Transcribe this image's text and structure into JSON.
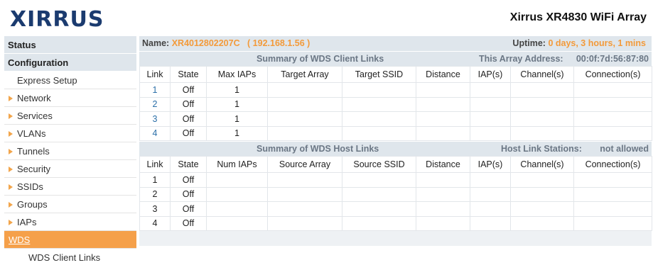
{
  "header": {
    "logo_text": "XIRRUS",
    "device_title": "Xirrus XR4830 WiFi Array",
    "brand_color": "#1b3b6f"
  },
  "sidebar": {
    "status": "Status",
    "configuration": "Configuration",
    "express_setup": "Express Setup",
    "items": [
      {
        "label": "Network"
      },
      {
        "label": "Services"
      },
      {
        "label": "VLANs"
      },
      {
        "label": "Tunnels"
      },
      {
        "label": "Security"
      },
      {
        "label": "SSIDs"
      },
      {
        "label": "Groups"
      },
      {
        "label": "IAPs"
      }
    ],
    "active_item": "WDS",
    "sub_item": "WDS Client Links",
    "accent_color": "#f5a04a"
  },
  "statusbar": {
    "name_label": "Name:",
    "name_value": "XR4012802207C",
    "ip_value": "( 192.168.1.56 )",
    "uptime_label": "Uptime:",
    "uptime_value": "0 days, 3 hours, 1 mins"
  },
  "client_links": {
    "title": "Summary of WDS Client Links",
    "address_label": "This Array Address:",
    "address_value": "00:0f:7d:56:87:80",
    "columns": [
      "Link",
      "State",
      "Max IAPs",
      "Target Array",
      "Target SSID",
      "Distance",
      "IAP(s)",
      "Channel(s)",
      "Connection(s)"
    ],
    "rows": [
      [
        "1",
        "Off",
        "1",
        "",
        "",
        "",
        "",
        "",
        ""
      ],
      [
        "2",
        "Off",
        "1",
        "",
        "",
        "",
        "",
        "",
        ""
      ],
      [
        "3",
        "Off",
        "1",
        "",
        "",
        "",
        "",
        "",
        ""
      ],
      [
        "4",
        "Off",
        "1",
        "",
        "",
        "",
        "",
        "",
        ""
      ]
    ]
  },
  "host_links": {
    "title": "Summary of WDS Host Links",
    "stations_label": "Host Link Stations:",
    "stations_value": "not allowed",
    "columns": [
      "Link",
      "State",
      "Num IAPs",
      "Source Array",
      "Source SSID",
      "Distance",
      "IAP(s)",
      "Channel(s)",
      "Connection(s)"
    ],
    "rows": [
      [
        "1",
        "Off",
        "",
        "",
        "",
        "",
        "",
        "",
        ""
      ],
      [
        "2",
        "Off",
        "",
        "",
        "",
        "",
        "",
        "",
        ""
      ],
      [
        "3",
        "Off",
        "",
        "",
        "",
        "",
        "",
        "",
        ""
      ],
      [
        "4",
        "Off",
        "",
        "",
        "",
        "",
        "",
        "",
        ""
      ]
    ]
  }
}
